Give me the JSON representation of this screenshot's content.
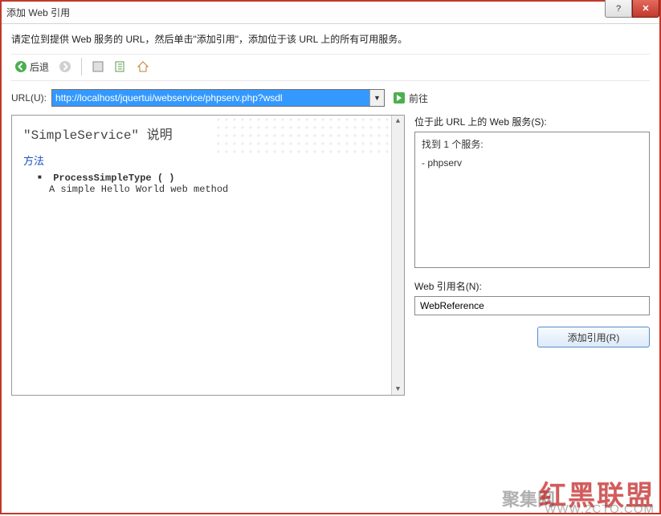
{
  "titlebar": {
    "title": "添加 Web 引用",
    "help": "?",
    "close": "✕"
  },
  "instructions": "请定位到提供 Web 服务的 URL，然后单击\"添加引用\"，添加位于该 URL 上的所有可用服务。",
  "toolbar": {
    "back": "后退"
  },
  "url": {
    "label": "URL(U):",
    "value": "http://localhost/jquertui/webservice/phpserv.php?wsdl",
    "go": "前往"
  },
  "description": {
    "title": "\"SimpleService\" 说明",
    "methods_header": "方法",
    "method_name": "ProcessSimpleType ( )",
    "method_desc": "A simple Hello World web method"
  },
  "right": {
    "services_label": "位于此 URL 上的 Web 服务(S):",
    "found": "找到 1 个服务:",
    "service_item": "- phpserv",
    "refname_label": "Web 引用名(N):",
    "refname_value": "WebReference",
    "add_btn": "添加引用(R)"
  },
  "watermarks": {
    "w1": "红黑联盟",
    "w2": "聚集网",
    "w3": "WWW.2CTO.COM"
  }
}
